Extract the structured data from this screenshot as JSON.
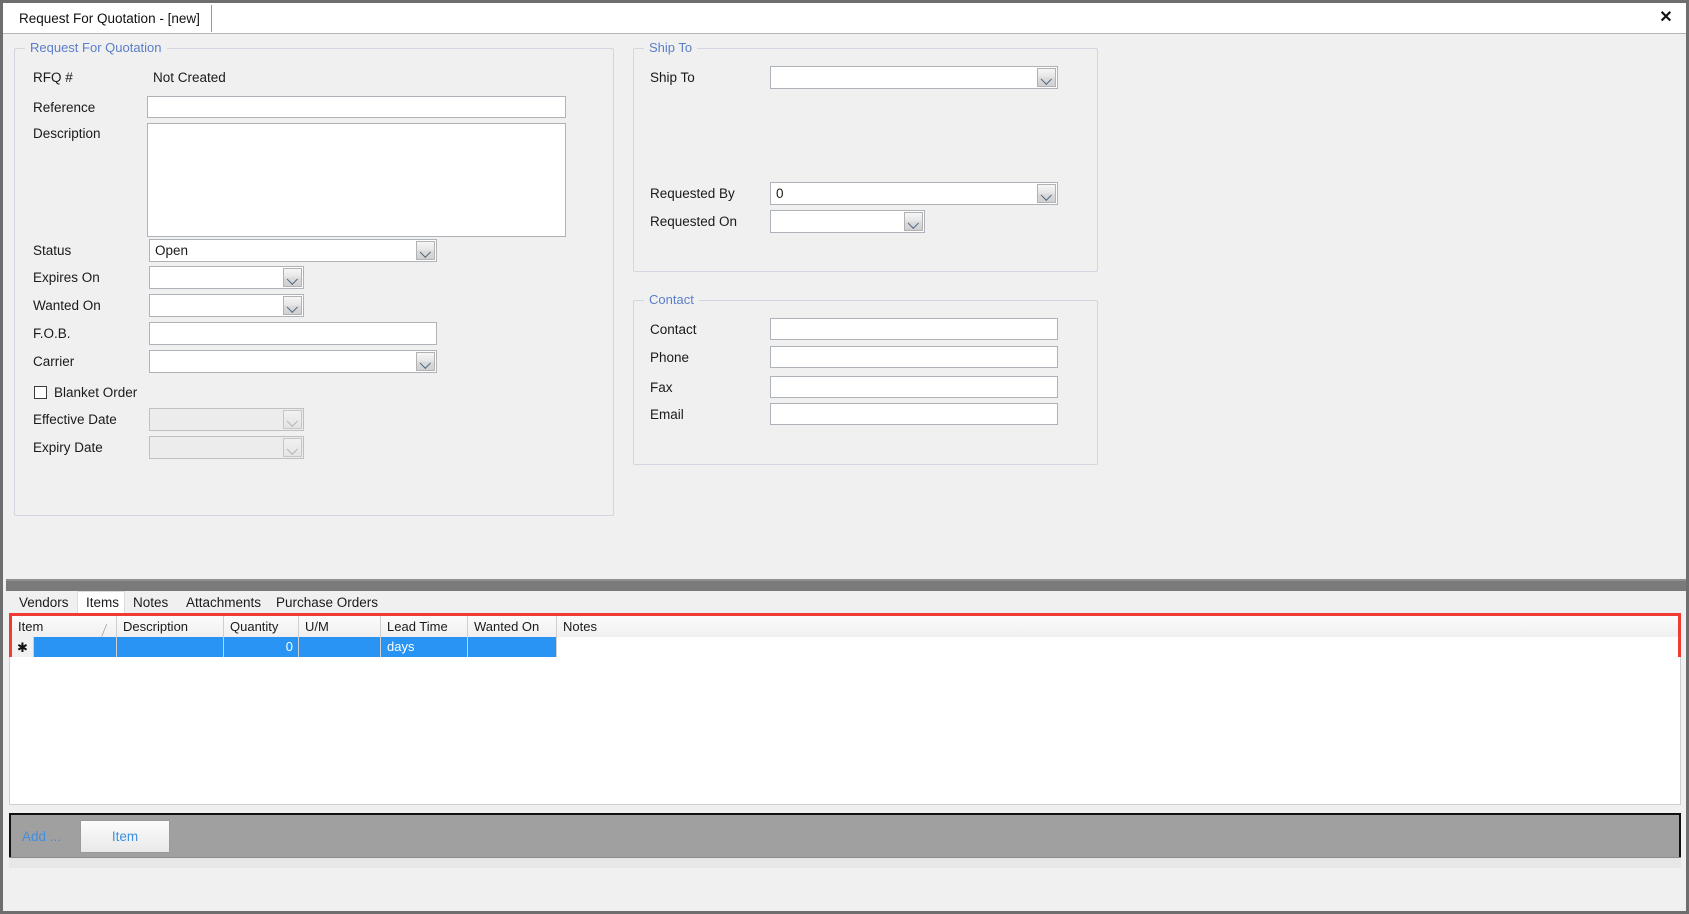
{
  "window": {
    "tab_title": "Request For Quotation - [new]",
    "close_label": "✕"
  },
  "rfq_group": {
    "title": "Request For Quotation",
    "fields": {
      "rfq_number_label": "RFQ #",
      "rfq_number_value": "Not Created",
      "reference_label": "Reference",
      "reference_value": "",
      "description_label": "Description",
      "description_value": "",
      "status_label": "Status",
      "status_value": "Open",
      "expires_on_label": "Expires On",
      "expires_on_value": "",
      "wanted_on_label": "Wanted On",
      "wanted_on_value": "",
      "fob_label": "F.O.B.",
      "fob_value": "",
      "carrier_label": "Carrier",
      "carrier_value": "",
      "blanket_order_label": "Blanket Order",
      "effective_date_label": "Effective Date",
      "effective_date_value": "",
      "expiry_date_label": "Expiry Date",
      "expiry_date_value": ""
    }
  },
  "ship_to_group": {
    "title": "Ship To",
    "fields": {
      "ship_to_label": "Ship To",
      "ship_to_value": "",
      "requested_by_label": "Requested By",
      "requested_by_value": "0",
      "requested_on_label": "Requested On",
      "requested_on_value": ""
    }
  },
  "contact_group": {
    "title": "Contact",
    "fields": {
      "contact_label": "Contact",
      "contact_value": "",
      "phone_label": "Phone",
      "phone_value": "",
      "fax_label": "Fax",
      "fax_value": "",
      "email_label": "Email",
      "email_value": ""
    }
  },
  "bottom_tabs": {
    "items": [
      {
        "label": "Vendors",
        "active": false
      },
      {
        "label": "Items",
        "active": true
      },
      {
        "label": "Notes",
        "active": false
      },
      {
        "label": "Attachments",
        "active": false
      },
      {
        "label": "Purchase Orders",
        "active": false
      }
    ]
  },
  "items_grid": {
    "columns": [
      "Item",
      "Description",
      "Quantity",
      "U/M",
      "Lead Time",
      "Wanted On",
      "Notes"
    ],
    "sort_indicator": "╱",
    "new_row_marker": "✱",
    "rows": [
      {
        "item": "",
        "description": "",
        "quantity": "0",
        "um": "",
        "lead_time": "days",
        "wanted_on": "",
        "notes": ""
      }
    ],
    "selection_color": "#2a94f4",
    "highlight_border_color": "#ef3b33"
  },
  "action_bar": {
    "add_label": "Add ...",
    "item_button_label": "Item"
  }
}
